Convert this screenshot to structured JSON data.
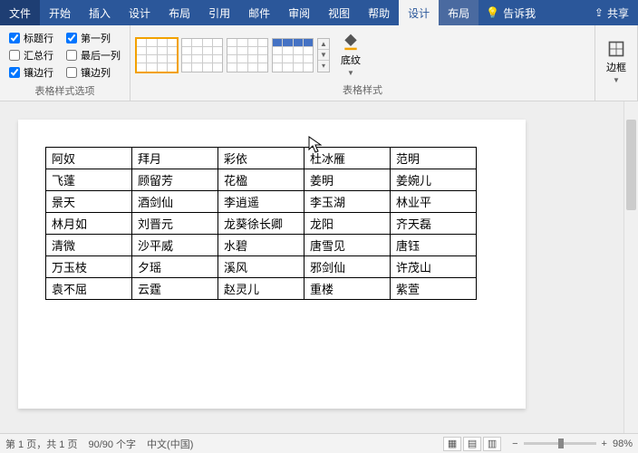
{
  "tabs": {
    "file": "文件",
    "home": "开始",
    "insert": "插入",
    "design": "设计",
    "layout": "布局",
    "references": "引用",
    "mail": "邮件",
    "review": "审阅",
    "view": "视图",
    "help": "帮助",
    "table_design": "设计",
    "table_layout": "布局",
    "tell_me": "告诉我",
    "share": "共享"
  },
  "ribbon": {
    "options_group": "表格样式选项",
    "styles_group": "表格样式",
    "opts": {
      "header_row": "标题行",
      "total_row": "汇总行",
      "banded_rows": "镶边行",
      "first_col": "第一列",
      "last_col": "最后一列",
      "banded_cols": "镶边列"
    },
    "shading": "底纹",
    "borders": "边框"
  },
  "table": {
    "rows": [
      [
        "阿奴",
        "拜月",
        "彩依",
        "杜冰雁",
        "范明"
      ],
      [
        "飞蓬",
        "顾留芳",
        "花楹",
        "姜明",
        "姜婉儿"
      ],
      [
        "景天",
        "酒剑仙",
        "李逍遥",
        "李玉湖",
        "林业平"
      ],
      [
        "林月如",
        "刘晋元",
        "龙葵徐长卿",
        "龙阳",
        "齐天磊"
      ],
      [
        "清微",
        "沙平威",
        "水碧",
        "唐雪见",
        "唐钰"
      ],
      [
        "万玉枝",
        "夕瑶",
        "溪风",
        "邪剑仙",
        "许茂山"
      ],
      [
        "袁不屈",
        "云霆",
        "赵灵儿",
        "重楼",
        "紫萱"
      ]
    ]
  },
  "status": {
    "page": "第 1 页，共 1 页",
    "words": "90/90 个字",
    "lang": "中文(中国)",
    "zoom": "98%"
  }
}
